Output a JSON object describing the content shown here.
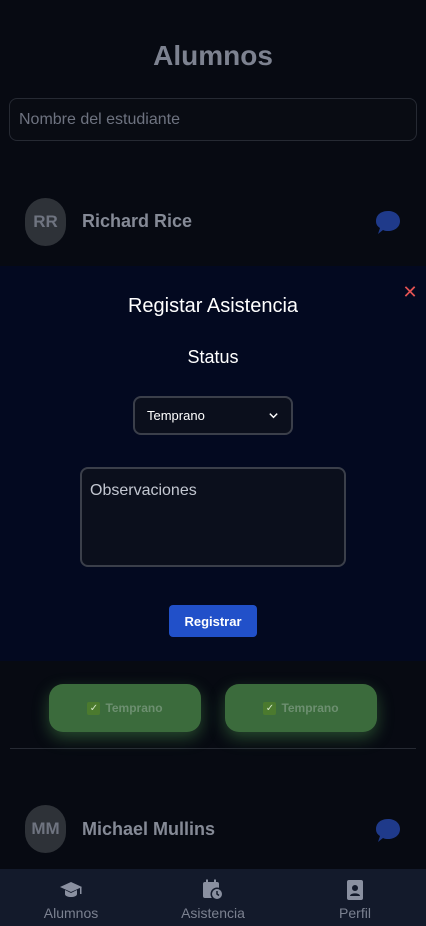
{
  "page": {
    "title": "Alumnos"
  },
  "search": {
    "placeholder": "Nombre del estudiante"
  },
  "students": [
    {
      "initials": "RR",
      "name": "Richard Rice"
    },
    {
      "initials": "MM",
      "name": "Michael Mullins"
    }
  ],
  "status_pills": [
    {
      "emoji": "✓",
      "label": "Temprano"
    },
    {
      "emoji": "✓",
      "label": "Temprano"
    }
  ],
  "modal": {
    "title": "Registar Asistencia",
    "close_symbol": "✕",
    "status_label": "Status",
    "status_selected": "Temprano",
    "observations_placeholder": "Observaciones",
    "submit_label": "Registrar"
  },
  "tabs": [
    {
      "label": "Alumnos",
      "icon": "graduation-cap-icon"
    },
    {
      "label": "Asistencia",
      "icon": "calendar-clock-icon"
    },
    {
      "label": "Perfil",
      "icon": "profile-badge-icon"
    }
  ],
  "colors": {
    "modal_bg": "#030920",
    "accent": "#2150c9",
    "close": "#e55353",
    "status_green": "#3b6b3c",
    "chat_icon": "#1f3a8a"
  }
}
